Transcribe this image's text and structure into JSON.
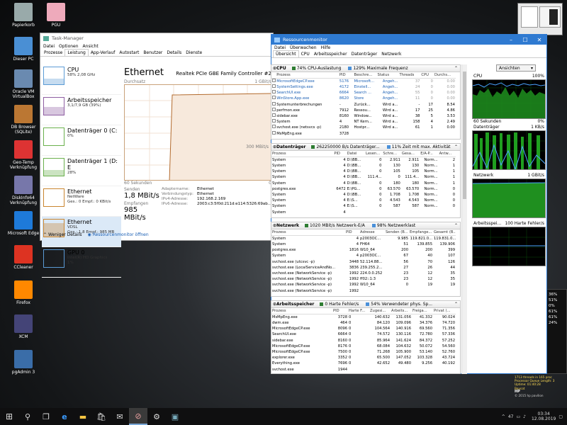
{
  "desktop": {
    "icons": [
      {
        "label": "Papierkorb"
      },
      {
        "label": "PGU"
      },
      {
        "label": "Dieser PC"
      },
      {
        "label": "Oracle VM VirtualBox"
      },
      {
        "label": "DB Browser (SQLite)"
      },
      {
        "label": "Geo-Temp Verknüpfung"
      },
      {
        "label": "DiskInfo64 Verknüpfung"
      },
      {
        "label": "Microsoft Edge"
      },
      {
        "label": "CCleaner"
      },
      {
        "label": "Firefox"
      },
      {
        "label": "XCM"
      },
      {
        "label": "pgAdmin 3"
      }
    ],
    "right_edge": [
      "36%",
      "51%",
      "0%",
      "61%",
      "61%",
      "24%"
    ],
    "widget_info": {
      "l1": "1713 threads in 165 proc",
      "l2": "Processor Queue Length: 3",
      "l3": "Uptime: 01:40:28",
      "l4": "Beycot",
      "brand": "HP",
      "l5": "© 2015 hp pavilion"
    }
  },
  "taskbar": {
    "time": "03:34",
    "date": "12.08.2019",
    "tray_number": "47"
  },
  "task_manager": {
    "title": "Task-Manager",
    "menu": [
      "Datei",
      "Optionen",
      "Ansicht"
    ],
    "tabs": [
      "Prozesse",
      "Leistung",
      "App-Verlauf",
      "Autostart",
      "Benutzer",
      "Details",
      "Dienste"
    ],
    "selected_tab": "Leistung",
    "sidebar": [
      {
        "title": "CPU",
        "sub1": "58% 2,08 GHz",
        "sub2": ""
      },
      {
        "title": "Arbeitsspeicher",
        "sub1": "3,1/7,9 GB (39%)",
        "sub2": ""
      },
      {
        "title": "Datenträger 0 (C:",
        "sub1": "0%",
        "sub2": ""
      },
      {
        "title": "Datenträger 1 (D: E",
        "sub1": "28%",
        "sub2": ""
      },
      {
        "title": "Ethernet",
        "sub1": "NetWare",
        "sub2": "Ges.: 0 Empf.: 0 KBit/s"
      },
      {
        "title": "Ethernet",
        "sub1": "VDSL",
        "sub2": "Ges.: 1,8 Empf.: 985 MB"
      },
      {
        "title": "GPU 0",
        "sub1": "Intel(R) HD Graphics",
        "sub2": "1%"
      }
    ],
    "detail": {
      "title": "Ethernet",
      "adapter": "Realtek PCIe GBE Family Controller #2",
      "graph_label": "Durchsatz",
      "graph_max": "1 GBit/s",
      "graph_mid": "300 MBit/s",
      "graph_time": "60 Sekunden",
      "graph_zero": "0",
      "send_label": "Senden",
      "send_value": "1,8 MBit/s",
      "recv_label": "Empfangen",
      "recv_value": "985 MBit/s",
      "props": [
        {
          "k": "Adaptername:",
          "v": "Ethernet"
        },
        {
          "k": "Verbindungstyp:",
          "v": "Ethernet"
        },
        {
          "k": "IPv4-Adresse:",
          "v": "192.168.2.169"
        },
        {
          "k": "IPv6-Adresse:",
          "v": "2003:c3:5f0d:211d:e114:5326:69ab..."
        }
      ]
    },
    "footer_less": "Weniger Details",
    "footer_resmon": "Ressourcenmonitor öffnen"
  },
  "resmon": {
    "title": "Ressourcenmonitor",
    "menu": [
      "Datei",
      "Überwachen",
      "Hilfe"
    ],
    "tabs": [
      "Übersicht",
      "CPU",
      "Arbeitsspeicher",
      "Datenträger",
      "Netzwerk"
    ],
    "selected_tab": "Übersicht",
    "cpu": {
      "name": "CPU",
      "pill1": "74% CPU-Auslastung",
      "pill2": "129% Maximale Frequenz",
      "pill1_color": "#2e7d32",
      "pill2_color": "#4a90d9",
      "headers": [
        "Prozess",
        "PID",
        "Beschre...",
        "Status",
        "Threads",
        "CPU",
        "Durchs..."
      ],
      "rows": [
        [
          "MicrosoftEdgeCP.exe",
          "5176",
          "Microsoft...",
          "Angeh...",
          "37",
          "0",
          "0.00"
        ],
        [
          "SystemSettings.exe",
          "4172",
          "Einstell...",
          "Angeh...",
          "24",
          "0",
          "0.00"
        ],
        [
          "SearchUI.exe",
          "6664",
          "Search ...",
          "Angeh...",
          "55",
          "0",
          "0.00"
        ],
        [
          "WinStore.App.exe",
          "8620",
          "Store",
          "Angeh...",
          "11",
          "0",
          "0.00"
        ],
        [
          "Systemunterbrechungen",
          "-",
          "Zurück...",
          "Wird a...",
          "-",
          "17",
          "8.54"
        ],
        [
          "perfmon.exe",
          "7912",
          "Ressou...",
          "Wird a...",
          "17",
          "25",
          "4.86"
        ],
        [
          "sidebar.exe",
          "8160",
          "Window...",
          "Wird a...",
          "38",
          "5",
          "3.53"
        ],
        [
          "System",
          "4",
          "NT Kern...",
          "Wird a...",
          "158",
          "4",
          "2.49"
        ],
        [
          "svchost.exe (netsvcs -p)",
          "2180",
          "Hostpr...",
          "Wird a...",
          "61",
          "1",
          "0.00"
        ],
        [
          "MsMpEng.exe",
          "3728",
          "",
          "",
          "",
          "",
          ""
        ]
      ]
    },
    "disk": {
      "name": "Datenträger",
      "pill1": "262250000 B/s Datenträger...",
      "pill2": "11% Zeit mit max. Aktivität",
      "pill1_color": "#2e7d32",
      "pill2_color": "#4a90d9",
      "headers": [
        "Prozess",
        "PID",
        "Datei",
        "Lesen...",
        "Schre...",
        "Gesa...",
        "E/A-P...",
        "Antw..."
      ],
      "rows": [
        [
          "System",
          "4",
          "D:\\BB...",
          "0",
          "2.911",
          "2.911",
          "Norm...",
          "2"
        ],
        [
          "System",
          "4",
          "D:\\BB...",
          "0",
          "130",
          "130",
          "Norm...",
          "1"
        ],
        [
          "System",
          "4",
          "D:\\BB...",
          "0",
          "105",
          "105",
          "Norm...",
          "1"
        ],
        [
          "System",
          "4",
          "D:\\BB...",
          "111.4...",
          "0",
          "111.4...",
          "Norm...",
          "1"
        ],
        [
          "System",
          "4",
          "D:\\BB...",
          "0",
          "180",
          "180",
          "Norm...",
          "1"
        ],
        [
          "postgres.exe",
          "6472",
          "E:\\PG...",
          "0",
          "63.570",
          "63.570",
          "Norm...",
          "0"
        ],
        [
          "System",
          "4",
          "D:\\BB...",
          "0",
          "1.708",
          "1.708",
          "Norm...",
          "0"
        ],
        [
          "System",
          "4",
          "E:\\S...",
          "0",
          "4.543",
          "4.543",
          "Norm...",
          "0"
        ],
        [
          "System",
          "4",
          "E:\\S...",
          "0",
          "587",
          "587",
          "Norm...",
          "0"
        ],
        [
          "System",
          "4",
          "",
          "",
          "",
          "",
          "",
          ""
        ]
      ]
    },
    "network": {
      "name": "Netzwerk",
      "pill1": "1020 MBit/s Netzwerk-E/A",
      "pill2": "98% Netzwerklast",
      "pill1_color": "#2e7d32",
      "pill2_color": "#4a90d9",
      "headers": [
        "Prozess",
        "PID",
        "Adresse",
        "Senden (B...",
        "Empfange...",
        "Gesamt (B..."
      ],
      "rows": [
        [
          "System",
          "4",
          "p2003OC...",
          "9.985",
          "119.821.0...",
          "119.831.0..."
        ],
        [
          "System",
          "4",
          "FH64",
          "51",
          "139.855",
          "139.906"
        ],
        [
          "postgres.exe",
          "1816",
          "W10_64",
          "200",
          "200",
          "399"
        ],
        [
          "System",
          "4",
          "p2003OC...",
          "67",
          "40",
          "107"
        ],
        [
          "svchost.exe (utcsvc -p)",
          "3448",
          "52.114.88...",
          "56",
          "70",
          "126"
        ],
        [
          "svchost.exe (LocalServiceAndNo...",
          "3836",
          "239.255.2...",
          "27",
          "26",
          "44"
        ],
        [
          "svchost.exe (NetworkService -p)",
          "1992",
          "224.0.0.252",
          "23",
          "12",
          "35"
        ],
        [
          "svchost.exe (NetworkService -p)",
          "1992",
          "ff02::1:3",
          "23",
          "12",
          "35"
        ],
        [
          "svchost.exe (NetworkService -p)",
          "1992",
          "W10_64",
          "0",
          "19",
          "19"
        ],
        [
          "svchost.exe (NetworkService -p)",
          "1992",
          "",
          "",
          "",
          ""
        ]
      ]
    },
    "memory": {
      "name": "Arbeitsspeicher",
      "pill1": "0 Harte Fehler/s",
      "pill2": "54% Verwendeter phys. Sp...",
      "pill1_color": "#2e7d32",
      "pill2_color": "#4a90d9",
      "headers": [
        "Prozess",
        "PID",
        "Harte F...",
        "Zugesi...",
        "Arbeits...",
        "Freiga...",
        "Privat (..."
      ],
      "rows": [
        [
          "MsMpEng.exe",
          "3728",
          "0",
          "140.632",
          "131.056",
          "41.332",
          "90.024"
        ],
        [
          "dwm.exe",
          "464",
          "0",
          "84.120",
          "109.096",
          "34.376",
          "74.720"
        ],
        [
          "MicrosoftEdgeCP.exe",
          "8096",
          "0",
          "104.564",
          "140.916",
          "69.560",
          "71.356"
        ],
        [
          "SearchUI.exe",
          "6664",
          "0",
          "74.572",
          "130.116",
          "72.780",
          "57.336"
        ],
        [
          "sidebar.exe",
          "8160",
          "0",
          "85.964",
          "141.624",
          "84.372",
          "57.252"
        ],
        [
          "MicrosoftEdgeCP.exe",
          "8176",
          "0",
          "68.084",
          "104.632",
          "50.072",
          "54.560"
        ],
        [
          "MicrosoftEdgeCP.exe",
          "7500",
          "0",
          "71.268",
          "105.900",
          "53.140",
          "52.760"
        ],
        [
          "explorer.exe",
          "3352",
          "0",
          "65.500",
          "147.052",
          "103.328",
          "43.724"
        ],
        [
          "Everything.exe",
          "7696",
          "0",
          "42.652",
          "49.480",
          "9.256",
          "40.192"
        ],
        [
          "svchost.exe",
          "1944",
          "",
          "",
          "",
          "",
          ""
        ]
      ]
    },
    "graphs": {
      "views_label": "Ansichten",
      "cpu_label": "CPU",
      "cpu_max": "100%",
      "cpu_time": "60 Sekunden",
      "cpu_min": "0%",
      "disk_label": "Datenträger",
      "disk_max": "1 KB/s",
      "net_label": "Netzwerk",
      "net_max": "1 GBit/s",
      "mem_label": "Arbeitsspei...",
      "mem_max": "100 Harte Fehler/s"
    }
  }
}
